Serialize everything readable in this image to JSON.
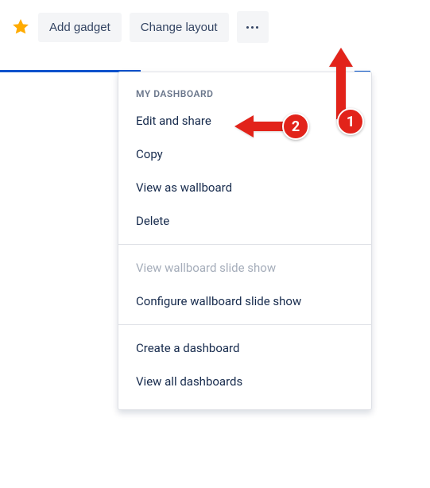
{
  "toolbar": {
    "add_gadget_label": "Add gadget",
    "change_layout_label": "Change layout"
  },
  "dropdown": {
    "header": "MY DASHBOARD",
    "section1": {
      "edit_share": "Edit and share",
      "copy": "Copy",
      "view_wallboard": "View as wallboard",
      "delete": "Delete"
    },
    "section2": {
      "view_slideshow": "View wallboard slide show",
      "configure_slideshow": "Configure wallboard slide show"
    },
    "section3": {
      "create_dashboard": "Create a dashboard",
      "view_all": "View all dashboards"
    }
  },
  "annotations": {
    "badge1": "1",
    "badge2": "2"
  }
}
